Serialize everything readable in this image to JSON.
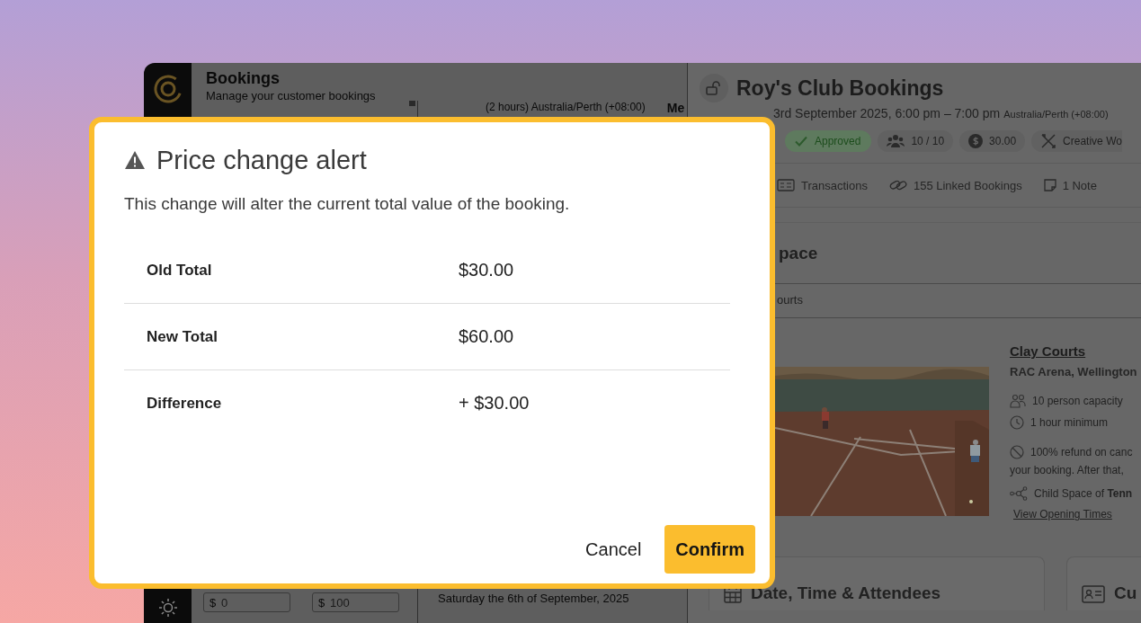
{
  "bookings_panel": {
    "title": "Bookings",
    "subtitle": "Manage your customer bookings",
    "list": {
      "column_1": "(2 hours) Australia/Perth (+08:00)",
      "column_2": "Me",
      "date_heading": "Saturday the 6th of September, 2025"
    },
    "filters": [
      {
        "prefix": "$",
        "placeholder": "0"
      },
      {
        "prefix": "$",
        "placeholder": "100"
      }
    ]
  },
  "booking_detail": {
    "title": "Roy's Club Bookings",
    "date": "3rd September 2025, 6:00 pm – 7:00 pm",
    "timezone": "Australia/Perth (+08:00)",
    "chips": [
      {
        "kind": "status",
        "label": "Approved"
      },
      {
        "kind": "attendees",
        "label": "10 / 10"
      },
      {
        "kind": "price",
        "label": "30.00"
      },
      {
        "kind": "category",
        "label": "Creative Wo"
      }
    ],
    "tabs": [
      {
        "kind": "transactions",
        "label": "Transactions"
      },
      {
        "kind": "linked",
        "label": "155 Linked Bookings"
      },
      {
        "kind": "note",
        "label": "1 Note"
      }
    ],
    "space": {
      "heading": "pace",
      "subheading": "ourts",
      "name": "Clay Courts",
      "location": "RAC Arena, Wellington",
      "features": [
        {
          "kind": "capacity",
          "text": "10 person capacity"
        },
        {
          "kind": "duration",
          "text": "1 hour minimum"
        },
        {
          "kind": "refund",
          "text": "100% refund on canc"
        },
        {
          "kind": "continued",
          "text": "your booking. After that,"
        },
        {
          "kind": "parent",
          "text": "Child Space of **Tenn**"
        }
      ],
      "link": "View Opening Times"
    },
    "cards": [
      {
        "kind": "calendar",
        "title": "Date, Time & Attendees"
      },
      {
        "kind": "contact",
        "title": "Cu"
      }
    ]
  },
  "dialog": {
    "title": "Price change alert",
    "message": "This change will alter the current total value of the booking.",
    "rows": [
      {
        "label": "Old Total",
        "value": "$30.00"
      },
      {
        "label": "New Total",
        "value": "$60.00"
      },
      {
        "label": "Difference",
        "value": "+ $30.00"
      }
    ],
    "buttons": [
      {
        "kind": "secondary",
        "label": "Cancel"
      },
      {
        "kind": "primary",
        "label": "Confirm"
      }
    ]
  }
}
